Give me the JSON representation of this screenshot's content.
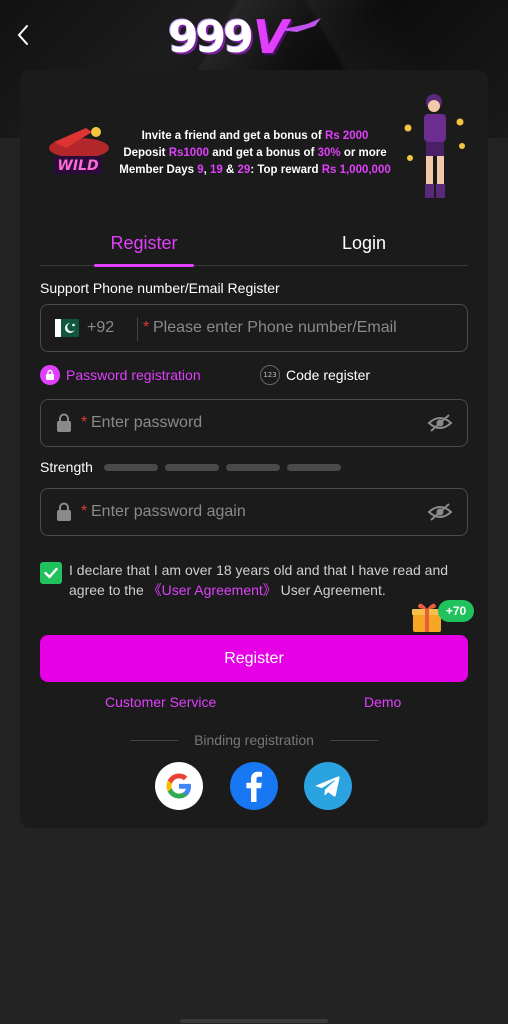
{
  "header": {
    "logo_text": "999",
    "logo_accent": "V"
  },
  "banner": {
    "line1_pre": "Invite a friend and get a bonus of ",
    "line1_amount": "Rs 2000",
    "line2_pre": "Deposit ",
    "line2_amount": "Rs1000",
    "line2_mid": " and get a bonus of ",
    "line2_pct": "30%",
    "line2_post": " or more",
    "line3_pre": "Member Days ",
    "line3_d1": "9",
    "line3_sep1": ", ",
    "line3_d2": "19",
    "line3_sep2": " & ",
    "line3_d3": "29",
    "line3_mid": ": Top reward ",
    "line3_reward": "Rs 1,000,000",
    "wild_text": "WILD"
  },
  "tabs": {
    "register": "Register",
    "login": "Login"
  },
  "form": {
    "support_label": "Support Phone number/Email Register",
    "country_code": "+92",
    "phone_placeholder": "Please enter Phone number/Email",
    "required_mark": "*",
    "option_password": "Password registration",
    "option_code": "Code register",
    "code_icon_text": "123",
    "password_placeholder": "Enter password",
    "strength_label": "Strength",
    "confirm_placeholder": "Enter password again",
    "agree_pre": "I declare that I am over 18 years old and that I have read and agree to the ",
    "agree_link": "《User Agreement》",
    "agree_post": " User Agreement.",
    "agree_checked": true,
    "bonus_badge": "+70",
    "register_button": "Register"
  },
  "links": {
    "customer_service": "Customer Service",
    "demo": "Demo",
    "binding_label": "Binding registration"
  },
  "social": [
    {
      "name": "google",
      "icon": "google-icon"
    },
    {
      "name": "facebook",
      "icon": "facebook-icon"
    },
    {
      "name": "telegram",
      "icon": "telegram-icon"
    }
  ],
  "colors": {
    "accent": "#e040fb",
    "register_button": "#e600e6",
    "check_green": "#21c25e",
    "background": "#232323",
    "card": "#1b1b1b"
  }
}
